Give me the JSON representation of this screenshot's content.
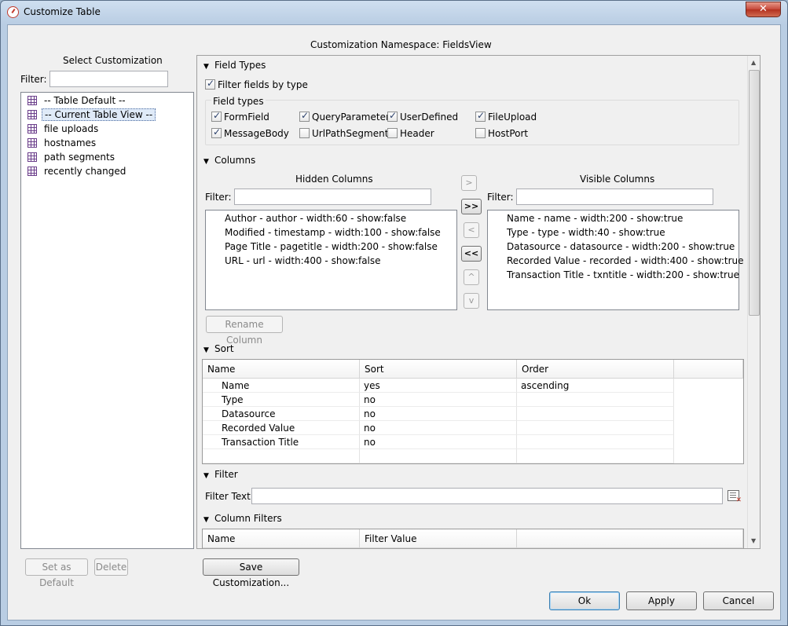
{
  "window": {
    "title": "Customize Table",
    "close_glyph": "✕"
  },
  "namespace_label": "Customization Namespace: FieldsView",
  "left": {
    "title": "Select Customization",
    "filter_label": "Filter:",
    "filter_value": "",
    "tree_items": [
      {
        "label": "-- Table Default --",
        "icon": "table-grid-icon",
        "selected": false
      },
      {
        "label": "-- Current Table View --",
        "icon": "table-grid-icon",
        "selected": true
      },
      {
        "label": "file uploads",
        "icon": "table-grid-icon",
        "selected": false
      },
      {
        "label": "hostnames",
        "icon": "table-grid-icon",
        "selected": false
      },
      {
        "label": "path segments",
        "icon": "table-grid-icon",
        "selected": false
      },
      {
        "label": "recently changed",
        "icon": "table-grid-icon",
        "selected": false
      }
    ],
    "set_default_label": "Set as Default",
    "delete_label": "Delete"
  },
  "field_types": {
    "header": "Field Types",
    "filter_by_type_label": "Filter fields by type",
    "filter_by_type_checked": true,
    "group_label": "Field types",
    "types": [
      {
        "label": "FormField",
        "checked": true
      },
      {
        "label": "QueryParameter",
        "checked": true
      },
      {
        "label": "UserDefined",
        "checked": true
      },
      {
        "label": "FileUpload",
        "checked": true
      },
      {
        "label": "MessageBody",
        "checked": true
      },
      {
        "label": "UrlPathSegment",
        "checked": false
      },
      {
        "label": "Header",
        "checked": false
      },
      {
        "label": "HostPort",
        "checked": false
      }
    ]
  },
  "columns": {
    "header": "Columns",
    "hidden_title": "Hidden Columns",
    "visible_title": "Visible Columns",
    "filter_label": "Filter:",
    "hidden": [
      "Author - author - width:60 - show:false",
      "Modified - timestamp - width:100 - show:false",
      "Page Title - pagetitle - width:200 - show:false",
      "URL - url - width:400 - show:false"
    ],
    "visible": [
      "Name - name - width:200 - show:true",
      "Type - type - width:40 - show:true",
      "Datasource - datasource - width:200 - show:true",
      "Recorded Value - recorded - width:400 - show:true",
      "Transaction Title - txntitle - width:200 - show:true"
    ],
    "move_right": ">",
    "move_all_right": ">>",
    "move_left": "<",
    "move_all_left": "<<",
    "move_up": "^",
    "move_down": "v",
    "rename_label": "Rename Column"
  },
  "sort": {
    "header": "Sort",
    "col_name": "Name",
    "col_sort": "Sort",
    "col_order": "Order",
    "rows": [
      {
        "name": "Name",
        "sort": "yes",
        "order": "ascending"
      },
      {
        "name": "Type",
        "sort": "no",
        "order": ""
      },
      {
        "name": "Datasource",
        "sort": "no",
        "order": ""
      },
      {
        "name": "Recorded Value",
        "sort": "no",
        "order": ""
      },
      {
        "name": "Transaction Title",
        "sort": "no",
        "order": ""
      }
    ]
  },
  "filter": {
    "header": "Filter",
    "text_label": "Filter Text:",
    "text_value": ""
  },
  "column_filters": {
    "header": "Column Filters",
    "col_name": "Name",
    "col_value": "Filter Value"
  },
  "save_customization_label": "Save Customization...",
  "footer": {
    "ok_label": "Ok",
    "apply_label": "Apply",
    "cancel_label": "Cancel"
  }
}
